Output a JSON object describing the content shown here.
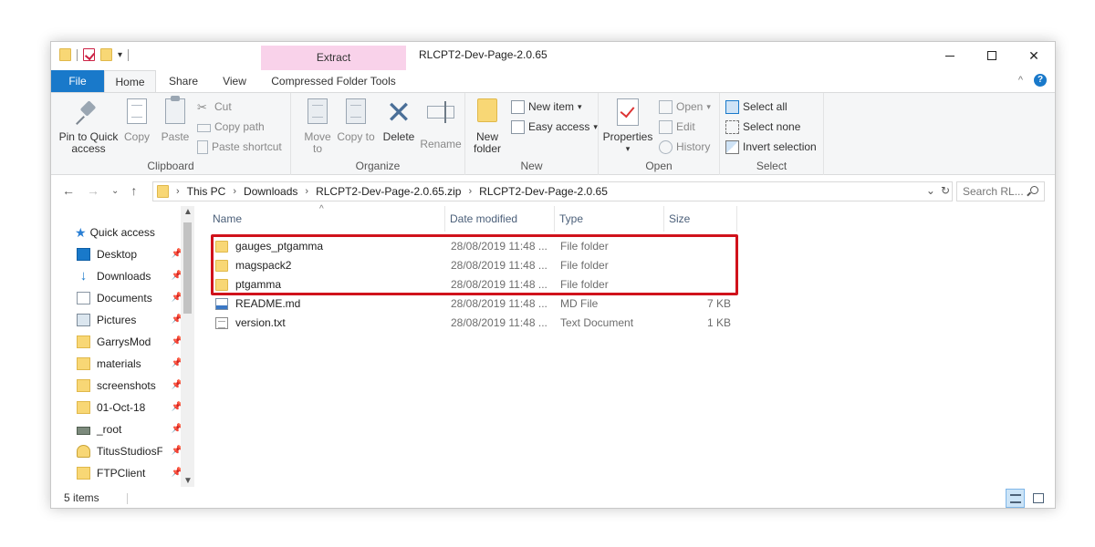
{
  "window": {
    "title": "RLCPT2-Dev-Page-2.0.65",
    "context_tab_header": "Extract",
    "controls": {
      "minimize": "",
      "maximize": "",
      "close": "✕"
    }
  },
  "tabs": [
    {
      "label": "File"
    },
    {
      "label": "Home"
    },
    {
      "label": "Share"
    },
    {
      "label": "View"
    },
    {
      "label": "Compressed Folder Tools"
    }
  ],
  "ribbon": {
    "clipboard": {
      "label": "Clipboard",
      "pin": "Pin to Quick access",
      "copy": "Copy",
      "paste": "Paste",
      "cut": "Cut",
      "copy_path": "Copy path",
      "paste_shortcut": "Paste shortcut"
    },
    "organize": {
      "label": "Organize",
      "move_to": "Move to",
      "copy_to": "Copy to",
      "delete": "Delete",
      "rename": "Rename"
    },
    "new": {
      "label": "New",
      "new_folder": "New folder",
      "new_item": "New item",
      "easy_access": "Easy access"
    },
    "open": {
      "label": "Open",
      "properties": "Properties",
      "open": "Open",
      "edit": "Edit",
      "history": "History"
    },
    "select": {
      "label": "Select",
      "select_all": "Select all",
      "select_none": "Select none",
      "invert": "Invert selection"
    }
  },
  "address": {
    "crumbs": [
      "This PC",
      "Downloads",
      "RLCPT2-Dev-Page-2.0.65.zip",
      "RLCPT2-Dev-Page-2.0.65"
    ],
    "search_placeholder": "Search RL..."
  },
  "navpane": {
    "quick_access": "Quick access",
    "items": [
      {
        "label": "Desktop",
        "icon": "desktop-icon"
      },
      {
        "label": "Downloads",
        "icon": "download-icon"
      },
      {
        "label": "Documents",
        "icon": "documents-icon"
      },
      {
        "label": "Pictures",
        "icon": "pictures-icon"
      },
      {
        "label": "GarrysMod",
        "icon": "folder-icon"
      },
      {
        "label": "materials",
        "icon": "folder-icon"
      },
      {
        "label": "screenshots",
        "icon": "folder-icon"
      },
      {
        "label": "01-Oct-18",
        "icon": "folder-icon"
      },
      {
        "label": "_root",
        "icon": "drive-icon"
      },
      {
        "label": "TitusStudiosF",
        "icon": "bulb-icon"
      },
      {
        "label": "FTPClient",
        "icon": "folder-icon"
      }
    ]
  },
  "filelist": {
    "columns": [
      "Name",
      "Date modified",
      "Type",
      "Size"
    ],
    "rows": [
      {
        "name": "gauges_ptgamma",
        "date": "28/08/2019 11:48 ...",
        "type": "File folder",
        "size": "",
        "icon": "folder-icon"
      },
      {
        "name": "magspack2",
        "date": "28/08/2019 11:48 ...",
        "type": "File folder",
        "size": "",
        "icon": "folder-icon"
      },
      {
        "name": "ptgamma",
        "date": "28/08/2019 11:48 ...",
        "type": "File folder",
        "size": "",
        "icon": "folder-icon"
      },
      {
        "name": "README.md",
        "date": "28/08/2019 11:48 ...",
        "type": "MD File",
        "size": "7 KB",
        "icon": "md-file-icon"
      },
      {
        "name": "version.txt",
        "date": "28/08/2019 11:48 ...",
        "type": "Text Document",
        "size": "1 KB",
        "icon": "text-file-icon"
      }
    ]
  },
  "status": {
    "count": "5 items"
  },
  "colors": {
    "accent": "#1979ca",
    "highlight_box": "#d0121b",
    "context_tab": "#f9d2ea"
  }
}
